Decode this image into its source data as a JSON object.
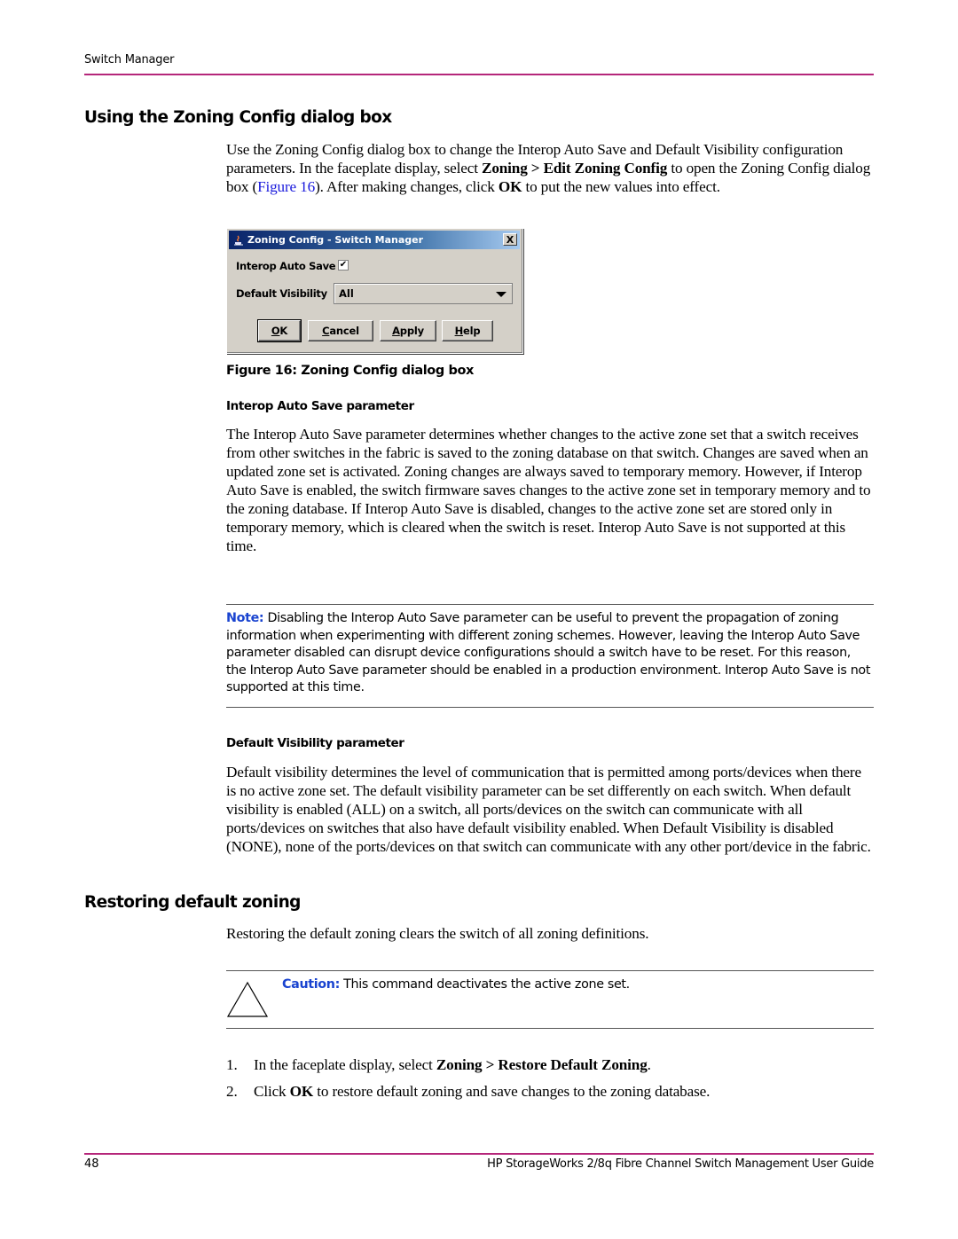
{
  "header": {
    "running_title": "Switch Manager"
  },
  "section1": {
    "heading": "Using the Zoning Config dialog box",
    "intro": {
      "t1": "Use the Zoning Config dialog box to change the Interop Auto Save and Default Visibility configuration parameters. In the faceplate display, select ",
      "b1": "Zoning > Edit Zoning Config",
      "t2": " to open the Zoning Config dialog box (",
      "link": "Figure 16",
      "t3": "). After making changes, click ",
      "b2": "OK",
      "t4": " to put the new values into effect."
    },
    "dialog": {
      "title": "Zoning Config - Switch Manager",
      "close_glyph": "X",
      "interop_label": "Interop Auto Save",
      "interop_checked": true,
      "check_glyph": "✔",
      "visibility_label": "Default Visibility",
      "visibility_value": "All",
      "buttons": [
        {
          "mnemonic": "O",
          "rest": "K"
        },
        {
          "mnemonic": "C",
          "rest": "ancel"
        },
        {
          "mnemonic": "A",
          "rest": "pply"
        },
        {
          "mnemonic": "H",
          "rest": "elp"
        }
      ]
    },
    "figure_caption": "Figure 16:  Zoning Config dialog box",
    "interop": {
      "heading": "Interop Auto Save parameter",
      "body": "The Interop Auto Save parameter determines whether changes to the active zone set that a switch receives from other switches in the fabric is saved to the zoning database on that switch. Changes are saved when an updated zone set is activated. Zoning changes are always saved to temporary memory. However, if Interop Auto Save is enabled, the switch firmware saves changes to the active zone set in temporary memory and to the zoning database. If Interop Auto Save is disabled, changes to the active zone set are stored only in temporary memory, which is cleared when the switch is reset. Interop Auto Save is not supported at this time."
    },
    "note": {
      "label": "Note:",
      "text": "  Disabling the Interop Auto Save parameter can be useful to prevent the propagation of zoning information when experimenting with different zoning schemes. However, leaving the Interop Auto Save parameter disabled can disrupt device configurations should a switch have to be reset. For this reason, the Interop Auto Save parameter should be enabled in a production environment. Interop Auto Save is not supported at this time."
    },
    "visibility": {
      "heading": "Default Visibility parameter",
      "body": "Default visibility determines the level of communication that is permitted among ports/devices when there is no active zone set. The default visibility parameter can be set differently on each switch. When default visibility is enabled (ALL) on a switch, all ports/devices on the switch can communicate with all ports/devices on switches that also have default visibility enabled. When Default Visibility is disabled (NONE), none of the ports/devices on that switch can communicate with any other port/device in the fabric."
    }
  },
  "section2": {
    "heading": "Restoring default zoning",
    "intro": "Restoring the default zoning clears the switch of all zoning definitions.",
    "caution": {
      "icon": "caution-triangle",
      "label": "Caution:",
      "text": "  This command deactivates the active zone set."
    },
    "steps": [
      {
        "num": "1.",
        "t1": "In the faceplate display, select ",
        "b": "Zoning > Restore Default Zoning",
        "t2": "."
      },
      {
        "num": "2.",
        "t1": "Click ",
        "b": "OK",
        "t2": " to restore default zoning and save changes to the zoning database."
      }
    ]
  },
  "footer": {
    "page_number": "48",
    "doc_title": "HP StorageWorks 2/8q Fibre Channel Switch Management User Guide"
  },
  "colors": {
    "rule_accent": "#b5267a",
    "link": "#1a1adc",
    "label_blue": "#1a44d0"
  }
}
